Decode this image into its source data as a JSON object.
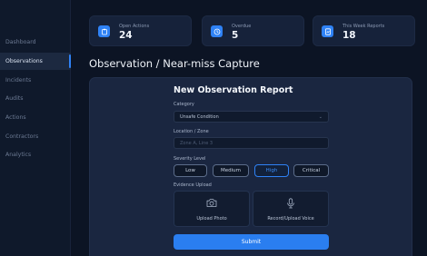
{
  "sidebar": {
    "items": [
      {
        "label": "Dashboard",
        "active": false
      },
      {
        "label": "Observations",
        "active": true
      },
      {
        "label": "Incidents",
        "active": false
      },
      {
        "label": "Audits",
        "active": false
      },
      {
        "label": "Actions",
        "active": false
      },
      {
        "label": "Contractors",
        "active": false
      },
      {
        "label": "Analytics",
        "active": false
      }
    ]
  },
  "stats": [
    {
      "label": "Open Actions",
      "value": "24",
      "icon": "clipboard-icon"
    },
    {
      "label": "Overdue",
      "value": "5",
      "icon": "clock-icon"
    },
    {
      "label": "This Week Reports",
      "value": "18",
      "icon": "report-icon"
    }
  ],
  "page": {
    "title": "Observation / Near-miss Capture"
  },
  "form": {
    "title": "New Observation Report",
    "category": {
      "label": "Category",
      "value": "Unsafe Condition"
    },
    "location": {
      "label": "Location / Zone",
      "placeholder": "Zone A, Line 3"
    },
    "severity": {
      "label": "Severity Level",
      "options": [
        "Low",
        "Medium",
        "High",
        "Critical"
      ],
      "selected": "High"
    },
    "evidence": {
      "label": "Evidence Upload",
      "photo_label": "Upload Photo",
      "voice_label": "Record/Upload Voice"
    },
    "submit_label": "Submit"
  },
  "colors": {
    "accent": "#2f82f5",
    "background": "#0c1424",
    "panel": "#1a2640"
  }
}
